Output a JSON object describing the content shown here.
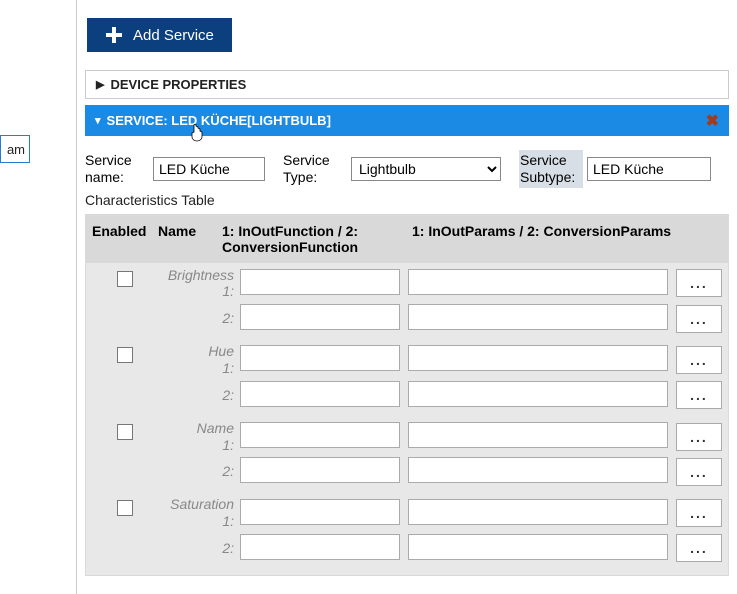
{
  "left_panel": {
    "selected_label": "am"
  },
  "buttons": {
    "add_service": "Add Service"
  },
  "sections": {
    "device_properties": "DEVICE PROPERTIES",
    "service_header": "SERVICE: LED KÜCHE[LIGHTBULB]"
  },
  "form": {
    "service_name_label": "Service name:",
    "service_name_value": "LED Küche",
    "service_type_label": "Service Type:",
    "service_type_value": "Lightbulb",
    "service_subtype_label": "Service Subtype:",
    "service_subtype_value": "LED Küche",
    "characteristics_table_label": "Characteristics Table"
  },
  "table": {
    "headers": {
      "enabled": "Enabled",
      "name": "Name",
      "col_func": "1: InOutFunction / 2: ConversionFunction",
      "col_params": "1: InOutParams / 2: ConversionParams"
    },
    "rows": [
      {
        "name": "Brightness",
        "r1": "1:",
        "r2": "2:",
        "dots": "..."
      },
      {
        "name": "Hue",
        "r1": "1:",
        "r2": "2:",
        "dots": "..."
      },
      {
        "name": "Name",
        "r1": "1:",
        "r2": "2:",
        "dots": "..."
      },
      {
        "name": "Saturation",
        "r1": "1:",
        "r2": "2:",
        "dots": "..."
      }
    ]
  }
}
